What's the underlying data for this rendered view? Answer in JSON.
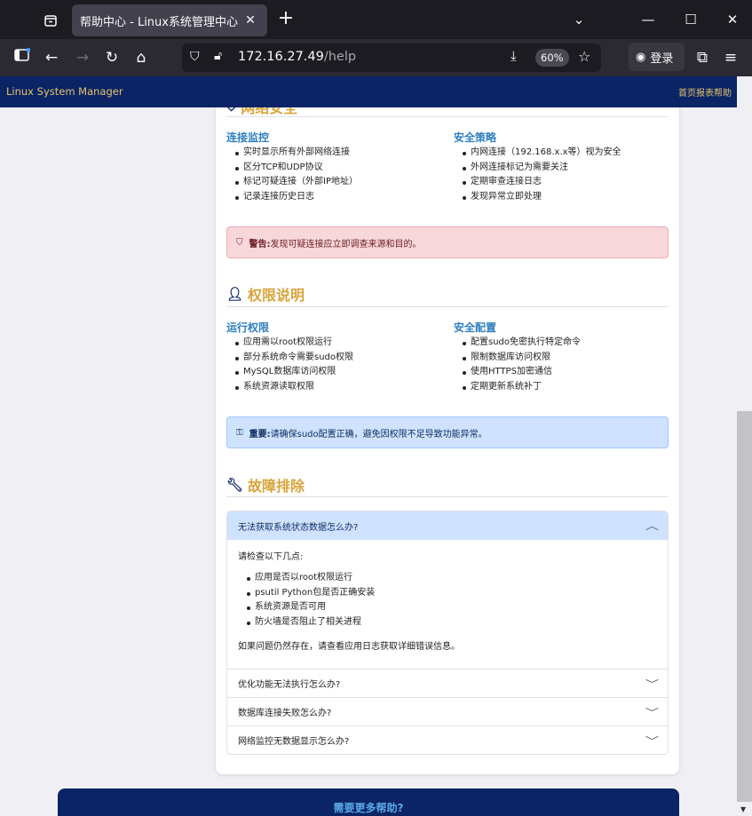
{
  "browser": {
    "tab_title": "帮助中心 - Linux系统管理中心",
    "url_host": "172.16.27.49",
    "url_path": "/help",
    "zoom": "60%",
    "login_label": "登录"
  },
  "app": {
    "brand": "Linux System Manager",
    "nav_right": "首页报表帮助"
  },
  "network": {
    "title": "网络安全",
    "left_heading": "连接监控",
    "left_items": [
      "实时显示所有外部网络连接",
      "区分TCP和UDP协议",
      "标记可疑连接（外部IP地址）",
      "记录连接历史日志"
    ],
    "right_heading": "安全策略",
    "right_items": [
      "内网连接（192.168.x.x等）视为安全",
      "外网连接标记为需要关注",
      "定期审查连接日志",
      "发现异常立即处理"
    ],
    "alert_bold": "警告:",
    "alert_text": "发现可疑连接应立即调查来源和目的。"
  },
  "permissions": {
    "title": "权限说明",
    "left_heading": "运行权限",
    "left_items": [
      "应用需以root权限运行",
      "部分系统命令需要sudo权限",
      "MySQL数据库访问权限",
      "系统资源读取权限"
    ],
    "right_heading": "安全配置",
    "right_items": [
      "配置sudo免密执行特定命令",
      "限制数据库访问权限",
      "使用HTTPS加密通信",
      "定期更新系统补丁"
    ],
    "alert_bold": "重要:",
    "alert_text": "请确保sudo配置正确，避免因权限不足导致功能异常。"
  },
  "troubleshoot": {
    "title": "故障排除",
    "faq": [
      {
        "question": "无法获取系统状态数据怎么办?"
      },
      {
        "question": "优化功能无法执行怎么办?"
      },
      {
        "question": "数据库连接失败怎么办?"
      },
      {
        "question": "网络监控无数据显示怎么办?"
      }
    ],
    "answer_intro": "请检查以下几点:",
    "answer_items": [
      "应用是否以root权限运行",
      "psutil Python包是否正确安装",
      "系统资源是否可用",
      "防火墙是否阻止了相关进程"
    ],
    "answer_outro": "如果问题仍然存在，请查看应用日志获取详细错误信息。"
  },
  "footer": {
    "banner": "需要更多帮助?"
  }
}
